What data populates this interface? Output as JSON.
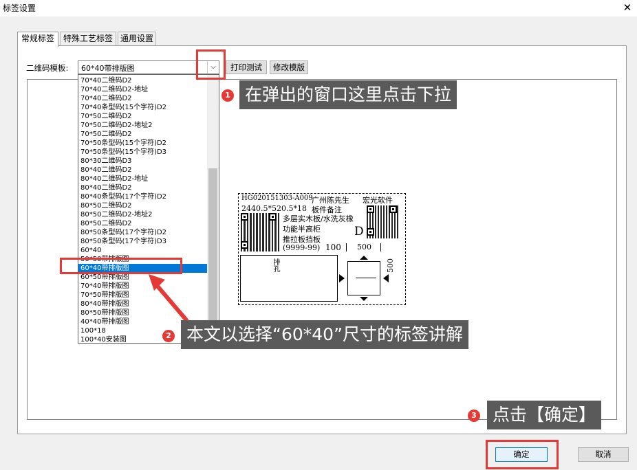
{
  "window": {
    "title": "标签设置",
    "close_glyph": "✕"
  },
  "tabs": [
    {
      "label": "常规标签",
      "active": true
    },
    {
      "label": "特殊工艺标签",
      "active": false
    },
    {
      "label": "通用设置",
      "active": false
    }
  ],
  "template": {
    "label": "二维码模板:",
    "selected": "60*40带排版图",
    "print_test": "打印测试",
    "edit_template": "修改模版"
  },
  "dropdown_options": [
    "70*40二维码D2",
    "70*40二维码D2-地址",
    "70*40二维码D2",
    "70*40条型码(15个字符)D2",
    "70*50二维码D2",
    "70*50二维码D2-地址2",
    "70*50二维码D2",
    "70*50条型码(15个字符)D2",
    "70*50条型码(15个字符)D3",
    "80*30二维码D3",
    "80*40二维码D2",
    "80*40二维码D2-地址",
    "80*40二维码D2",
    "80*40条型码(17个字符)D2",
    "80*50二维码D2",
    "80*50二维码D2-地址2",
    "80*50二维码D2",
    "80*50条型码(17个字符)D2",
    "80*50条型码(17个字符)D3",
    "60*40",
    "50*50带排版图",
    "60*40带排版图",
    "60*50带排版图",
    "70*40带排版图",
    "70*50带排版图",
    "80*40带排版图",
    "80*50带排版图",
    "40*40带排版图",
    "100*18",
    "100*40安装图"
  ],
  "selected_option_index": 21,
  "label_preview": {
    "line1_code": "HG020151303-A009",
    "line1_customer": "广州陈先生",
    "line1_company": "宏光软件",
    "line2_size": "2440.5*520.5*18",
    "line2_note": "板件备注",
    "material": "多层实木板/水洗灰橡",
    "function": "功能半高柜",
    "part": "推拉板挡板",
    "range": "(9999-99)",
    "qty": "100",
    "d_mark": "D",
    "width_dim": "500",
    "height_dim": "500",
    "vertical_text": "排孔"
  },
  "callouts": [
    {
      "num": "1",
      "text": "在弹出的窗口这里点击下拉"
    },
    {
      "num": "2",
      "text": "本文以选择“60*40”尺寸的标签讲解"
    },
    {
      "num": "3",
      "text": "点击【确定】"
    }
  ],
  "footer": {
    "ok": "确定",
    "cancel": "取消"
  },
  "colors": {
    "highlight_red": "#e53935",
    "selection_blue": "#0078d7",
    "callout_bg": "#5a5a5a"
  }
}
